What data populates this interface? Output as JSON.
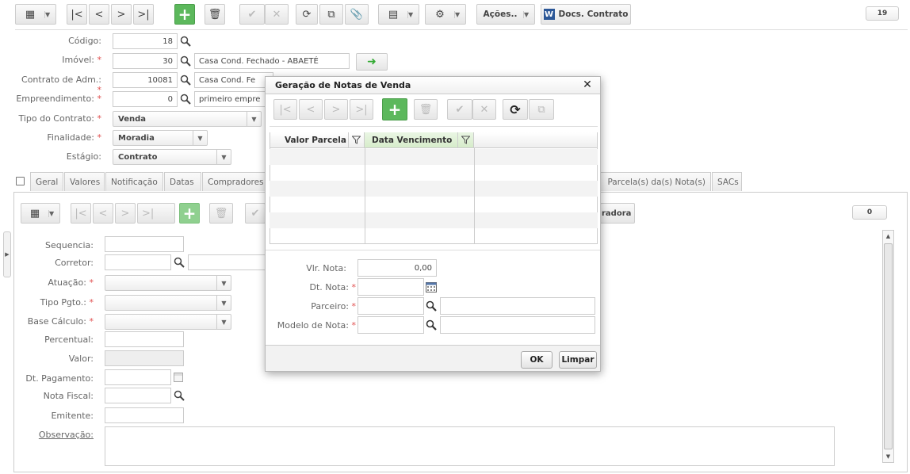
{
  "toolbar": {
    "acoes_label": "Ações..",
    "docs_label": "Docs. Contrato",
    "docs_icon_letter": "W",
    "count": "19"
  },
  "form": {
    "codigo": {
      "label": "Código:",
      "value": "18"
    },
    "imovel": {
      "label": "Imóvel:",
      "value": "30",
      "desc": "Casa Cond. Fechado - ABAETÉ"
    },
    "contrato_adm": {
      "label": "Contrato de Adm.:",
      "value": "10081",
      "desc": "Casa Cond. Fe"
    },
    "empreendimento": {
      "label": "Empreendimento:",
      "value": "0",
      "desc": "primeiro empre"
    },
    "tipo_contrato": {
      "label": "Tipo do Contrato:",
      "value": "Venda"
    },
    "finalidade": {
      "label": "Finalidade:",
      "value": "Moradia"
    },
    "estagio": {
      "label": "Estágio:",
      "value": "Contrato"
    }
  },
  "tabs": [
    "Geral",
    "Valores",
    "Notificação",
    "Datas",
    "Compradores",
    "Parcela(s) da(s) Nota(s)",
    "SACs"
  ],
  "sub": {
    "count": "0",
    "button_partial": "radora",
    "fields": {
      "sequencia": "Sequencia:",
      "corretor": "Corretor:",
      "atuacao": "Atuação:",
      "tipo_pgto": "Tipo Pgto.:",
      "base_calculo": "Base Cálculo:",
      "percentual": "Percentual:",
      "valor": "Valor:",
      "dt_pagamento": "Dt. Pagamento:",
      "nota_fiscal": "Nota Fiscal:",
      "emitente": "Emitente:",
      "observacao": "Observação:"
    }
  },
  "modal": {
    "title": "Geração de Notas de Venda",
    "close": "✕",
    "col_valor": "Valor Parcela",
    "col_data": "Data Vencimento",
    "vlr_nota_label": "Vlr. Nota:",
    "vlr_nota_value": "0,00",
    "dt_nota_label": "Dt. Nota:",
    "parceiro_label": "Parceiro:",
    "modelo_label": "Modelo de Nota:",
    "ok": "OK",
    "limpar": "Limpar"
  },
  "colors": {
    "green": "#5cb85c",
    "required": "#e05050",
    "grid_header_active": "#dff0d8"
  }
}
